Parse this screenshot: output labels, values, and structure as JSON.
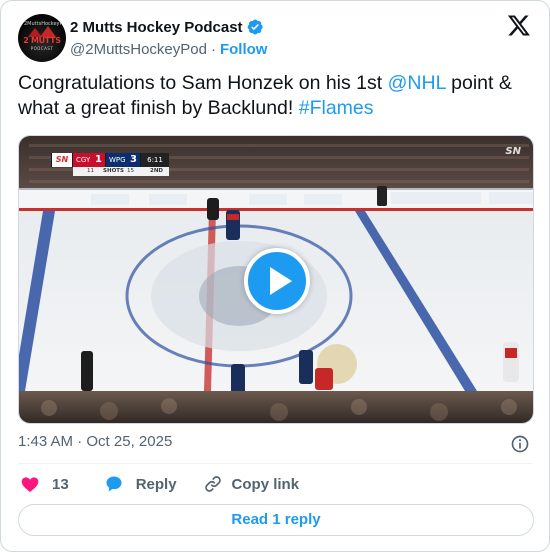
{
  "author": {
    "display_name": "2 Mutts Hockey Podcast",
    "handle": "@2MuttsHockeyPod",
    "follow_label": "Follow",
    "avatar": {
      "top_text": "2MuttsHockeyPodcast.com",
      "main_text": "2 MUTTS",
      "sub_text": "PODCAST"
    },
    "verified_icon": "verified-badge-icon"
  },
  "tweet": {
    "text_before": "Congratulations to Sam Honzek on his 1st ",
    "mention": "@NHL",
    "text_middle": " point & what a great finish by Backlund! ",
    "hashtag": "#Flames"
  },
  "media": {
    "scorebug": {
      "network": "SN",
      "team_home": "CGY",
      "score_home": "1",
      "team_away": "WPG",
      "score_away": "3",
      "clock": "6:11",
      "shots_home": "11",
      "shots_label": "SHOTS",
      "shots_away": "15",
      "period": "2ND"
    },
    "corner_logo": "SN",
    "play_icon": "play-icon"
  },
  "timestamp": {
    "time": "1:43 AM",
    "date": "Oct 25, 2025"
  },
  "actions": {
    "like_count": "13",
    "reply_label": "Reply",
    "copy_label": "Copy link"
  },
  "read_reply_label": "Read 1 reply",
  "colors": {
    "accent": "#1d9bf0",
    "like": "#f91880",
    "text": "#0f1419",
    "muted": "#536471"
  }
}
